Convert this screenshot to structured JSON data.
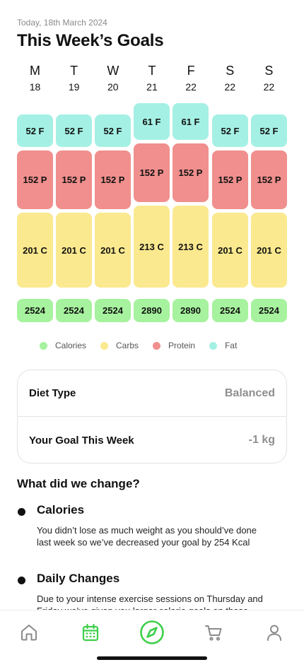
{
  "header": {
    "date": "Today, 18th March 2024",
    "title": "This Week’s Goals"
  },
  "days": [
    {
      "letter": "M",
      "num": "18",
      "fat": "52 F",
      "protein": "152 P",
      "carbs": "201 C",
      "calories": "2524"
    },
    {
      "letter": "T",
      "num": "19",
      "fat": "52 F",
      "protein": "152 P",
      "carbs": "201 C",
      "calories": "2524"
    },
    {
      "letter": "W",
      "num": "20",
      "fat": "52 F",
      "protein": "152 P",
      "carbs": "201 C",
      "calories": "2524"
    },
    {
      "letter": "T",
      "num": "21",
      "fat": "61 F",
      "protein": "152 P",
      "carbs": "213 C",
      "calories": "2890"
    },
    {
      "letter": "F",
      "num": "22",
      "fat": "61 F",
      "protein": "152 P",
      "carbs": "213 C",
      "calories": "2890"
    },
    {
      "letter": "S",
      "num": "22",
      "fat": "52 F",
      "protein": "152 P",
      "carbs": "201 C",
      "calories": "2524"
    },
    {
      "letter": "S",
      "num": "22",
      "fat": "52 F",
      "protein": "152 P",
      "carbs": "201 C",
      "calories": "2524"
    }
  ],
  "legend": [
    {
      "label": "Calories",
      "color": "#a6f29e"
    },
    {
      "label": "Carbs",
      "color": "#fbe98f"
    },
    {
      "label": "Protein",
      "color": "#f08f8d"
    },
    {
      "label": "Fat",
      "color": "#a5f0e4"
    }
  ],
  "summary": {
    "diet_type_label": "Diet Type",
    "diet_type_value": "Balanced",
    "goal_label": "Your Goal This Week",
    "goal_value": "-1 kg"
  },
  "changes": {
    "heading": "What did we change?",
    "items": [
      {
        "title": "Calories",
        "text": "You didn’t lose as much weight as you should’ve done last week so we’ve decreased your goal by 254 Kcal"
      },
      {
        "title": "Daily Changes",
        "text": "Due to your intense exercise sessions on Thursday and Friday we’ve given you larger calorie goals on those days"
      }
    ]
  },
  "nav": {
    "items": [
      "home-icon",
      "calendar-icon",
      "compass-icon",
      "cart-icon",
      "profile-icon"
    ],
    "active_color": "#3ecf4a",
    "inactive_color": "#8a8a8a"
  }
}
